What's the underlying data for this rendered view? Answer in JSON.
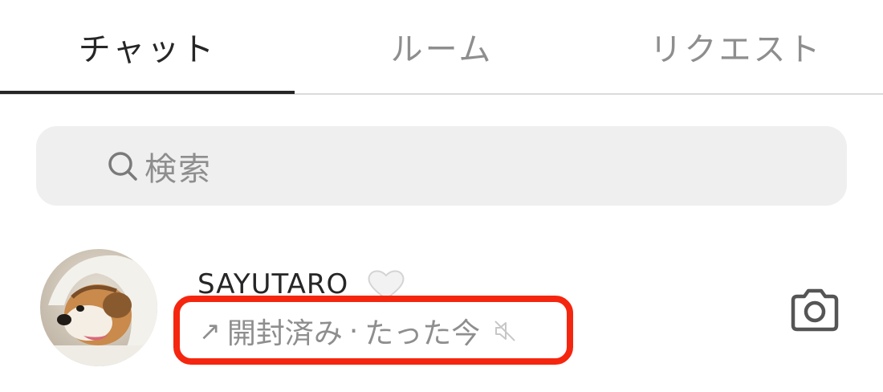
{
  "tabs": [
    {
      "label": "チャット",
      "active": true
    },
    {
      "label": "ルーム",
      "active": false
    },
    {
      "label": "リクエスト",
      "active": false
    }
  ],
  "search": {
    "placeholder": "検索",
    "icon": "search-icon"
  },
  "chat": {
    "username": "SAYUTARO",
    "username_badge_icon": "white-heart-icon",
    "status_icon": "sent-arrow-icon",
    "status_arrow": "↗",
    "status": "開封済み",
    "separator": "·",
    "time": "たった今",
    "mute_icon": "muted-speaker-icon",
    "action_icon": "camera-icon"
  },
  "colors": {
    "primary_text": "#262626",
    "secondary_text": "#8e8e8e",
    "search_bg": "#efefef",
    "highlight": "#f5260f"
  }
}
